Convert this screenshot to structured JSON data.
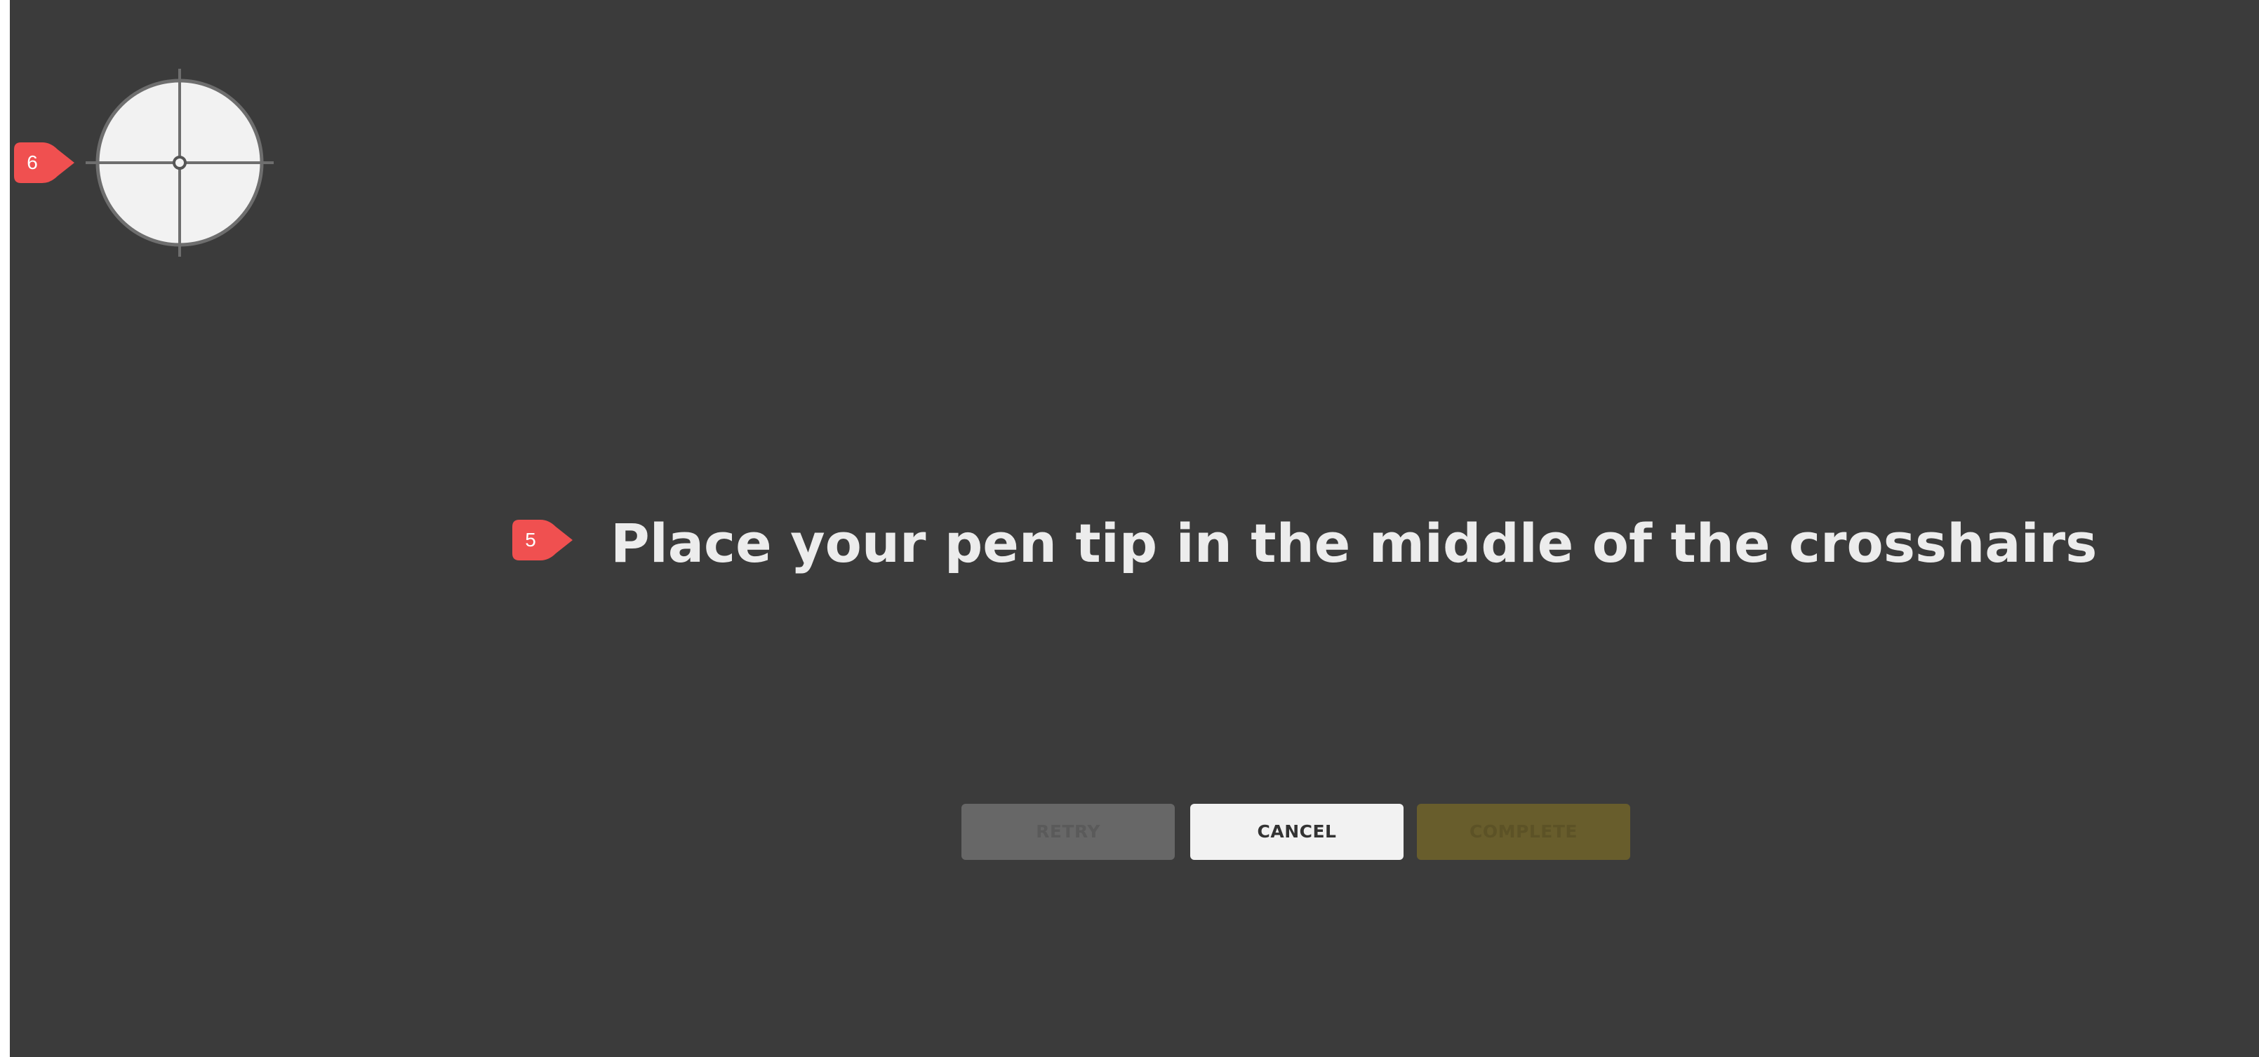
{
  "instruction": {
    "text": "Place your pen tip in the middle of the crosshairs"
  },
  "markers": {
    "crosshair_marker": "6",
    "instruction_marker": "5"
  },
  "buttons": {
    "retry_label": "RETRY",
    "cancel_label": "CANCEL",
    "complete_label": "COMPLETE"
  },
  "colors": {
    "background": "#3b3b3b",
    "marker": "#f05050",
    "crosshair_fill": "#f2f2f2",
    "crosshair_stroke": "#6e6e6e",
    "retry_disabled": "#676767",
    "cancel": "#f2f2f2",
    "complete_disabled": "#685d2c"
  },
  "icons": {
    "calibration_target": "crosshair-target-icon",
    "annotation_marker": "pin-marker-icon"
  }
}
